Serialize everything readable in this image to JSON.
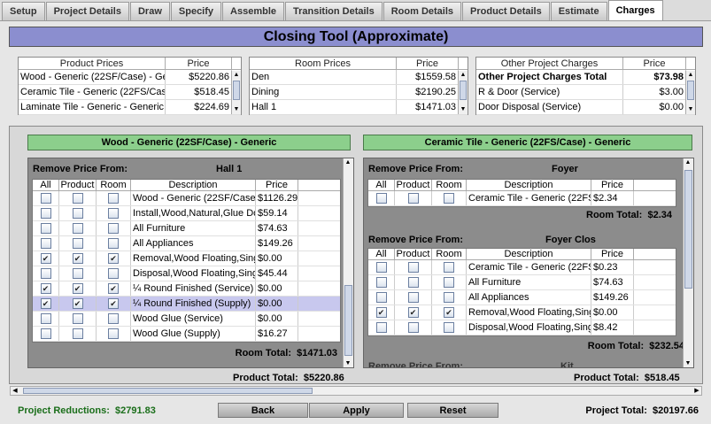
{
  "tabs": [
    "Setup",
    "Project Details",
    "Draw",
    "Specify",
    "Assemble",
    "Transition Details",
    "Room Details",
    "Product Details",
    "Estimate",
    "Charges"
  ],
  "title": "Closing Tool (Approximate)",
  "product_prices": {
    "h1": "Product Prices",
    "h2": "Price",
    "rows": [
      {
        "d": "Wood - Generic (22SF/Case) - Ge...",
        "p": "$5220.86"
      },
      {
        "d": "Ceramic Tile - Generic (22FS/Cas...",
        "p": "$518.45"
      },
      {
        "d": "Laminate Tile - Generic - Generic",
        "p": "$224.69"
      }
    ]
  },
  "room_prices": {
    "h1": "Room Prices",
    "h2": "Price",
    "rows": [
      {
        "d": "Den",
        "p": "$1559.58"
      },
      {
        "d": "Dining",
        "p": "$2190.25"
      },
      {
        "d": "Hall 1",
        "p": "$1471.03"
      }
    ]
  },
  "other_charges": {
    "h1": "Other Project Charges",
    "h2": "Price",
    "rows": [
      {
        "d": "Other Project Charges Total",
        "p": "$73.98"
      },
      {
        "d": "R & Door (Service)",
        "p": "$3.00"
      },
      {
        "d": "Door Disposal (Service)",
        "p": "$0.00"
      }
    ]
  },
  "left": {
    "header": "Wood - Generic (22SF/Case) - Generic",
    "remove_label": "Remove Price From:",
    "room": "Hall 1",
    "cols": [
      "All",
      "Product",
      "Room",
      "Description",
      "Price"
    ],
    "rows": [
      {
        "a": "",
        "b": "",
        "c": "",
        "d": "Wood - Generic (22SF/Case) - ...",
        "p": "$1126.29"
      },
      {
        "a": "",
        "b": "",
        "c": "",
        "d": "Install,Wood,Natural,Glue Down...",
        "p": "$59.14"
      },
      {
        "a": "",
        "b": "",
        "c": "",
        "d": "All Furniture",
        "p": "$74.63"
      },
      {
        "a": "",
        "b": "",
        "c": "",
        "d": "All Appliances",
        "p": "$149.26"
      },
      {
        "a": "✔",
        "b": "✔",
        "c": "✔",
        "d": "Removal,Wood Floating,Single ...",
        "p": "$0.00"
      },
      {
        "a": "",
        "b": "",
        "c": "",
        "d": "Disposal,Wood Floating,Single ...",
        "p": "$45.44"
      },
      {
        "a": "✔",
        "b": "✔",
        "c": "✔",
        "d": "¼ Round Finished (Service)",
        "p": "$0.00"
      },
      {
        "a": "✔",
        "b": "✔",
        "c": "✔",
        "d": "¼ Round Finished (Supply)",
        "p": "$0.00"
      },
      {
        "a": "",
        "b": "",
        "c": "",
        "d": "Wood Glue (Service)",
        "p": "$0.00"
      },
      {
        "a": "",
        "b": "",
        "c": "",
        "d": "Wood Glue (Supply)",
        "p": "$16.27"
      }
    ],
    "room_total_label": "Room Total:",
    "room_total": "$1471.03",
    "product_total_label": "Product Total:",
    "product_total": "$5220.86"
  },
  "right": {
    "header": "Ceramic Tile - Generic (22FS/Case) - Generic",
    "remove_label": "Remove Price From:",
    "cols": [
      "All",
      "Product",
      "Room",
      "Description",
      "Price"
    ],
    "room1": "Foyer",
    "rows1": [
      {
        "a": "",
        "b": "",
        "c": "",
        "d": "Ceramic Tile - Generic (22FS/C...",
        "p": "$2.34"
      }
    ],
    "room1_total": "$2.34",
    "room2": "Foyer Clos",
    "rows2": [
      {
        "a": "",
        "b": "",
        "c": "",
        "d": "Ceramic Tile - Generic (22FS/C...",
        "p": "$0.23"
      },
      {
        "a": "",
        "b": "",
        "c": "",
        "d": "All Furniture",
        "p": "$74.63"
      },
      {
        "a": "",
        "b": "",
        "c": "",
        "d": "All Appliances",
        "p": "$149.26"
      },
      {
        "a": "✔",
        "b": "✔",
        "c": "✔",
        "d": "Removal,Wood Floating,Single ...",
        "p": "$0.00"
      },
      {
        "a": "",
        "b": "",
        "c": "",
        "d": "Disposal,Wood Floating,Single ...",
        "p": "$8.42"
      }
    ],
    "room2_total": "$232.54",
    "room3": "Kit",
    "room_total_label": "Room Total:",
    "product_total_label": "Product Total:",
    "product_total": "$518.45"
  },
  "footer": {
    "reductions_label": "Project Reductions:",
    "reductions": "$2791.83",
    "back": "Back",
    "apply": "Apply",
    "reset": "Reset",
    "total_label": "Project Total:",
    "total": "$20197.66"
  }
}
